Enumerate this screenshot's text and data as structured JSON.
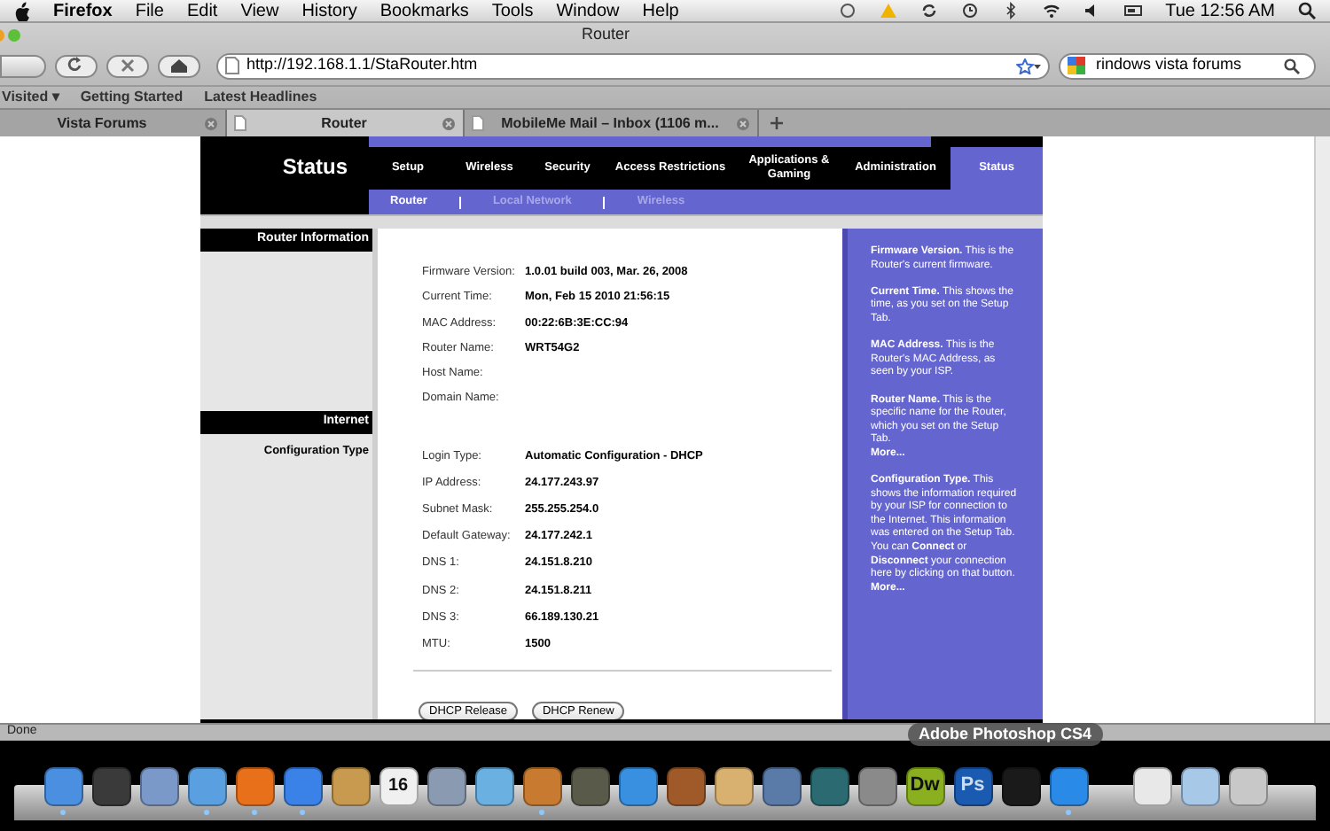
{
  "menu_bar": {
    "items": [
      "Firefox",
      "File",
      "Edit",
      "View",
      "History",
      "Bookmarks",
      "Tools",
      "Window",
      "Help"
    ],
    "clock": "Tue 12:56 AM"
  },
  "window": {
    "title": "Router"
  },
  "toolbar": {
    "url": "http://192.168.1.1/StaRouter.htm",
    "search": "rindows vista forums"
  },
  "bookmarks": [
    "Visited ▾",
    "Getting Started",
    "Latest Headlines"
  ],
  "tabs": [
    {
      "label": "Vista Forums",
      "selected": false
    },
    {
      "label": "Router",
      "selected": true
    },
    {
      "label": "MobileMe Mail – Inbox (1106 m...",
      "selected": false
    }
  ],
  "router": {
    "title": "Status",
    "tabs": [
      {
        "label": "Setup",
        "selected": false
      },
      {
        "label": "Wireless",
        "selected": false
      },
      {
        "label": "Security",
        "selected": false
      },
      {
        "label": "Access Restrictions",
        "selected": false
      },
      {
        "label": "Applications & Gaming",
        "selected": false
      },
      {
        "label": "Administration",
        "selected": false
      },
      {
        "label": "Status",
        "selected": true
      }
    ],
    "subtabs": [
      {
        "label": "Router",
        "selected": true
      },
      {
        "label": "Local Network",
        "selected": false
      },
      {
        "label": "Wireless",
        "selected": false
      }
    ],
    "sections": [
      {
        "heading": "Router Information",
        "rows": [
          {
            "label": "Firmware Version:",
            "value": "1.0.01 build 003, Mar. 26, 2008"
          },
          {
            "label": "Current Time:",
            "value": "Mon, Feb 15 2010 21:56:15"
          },
          {
            "label": "MAC Address:",
            "value": "00:22:6B:3E:CC:94"
          },
          {
            "label": "Router Name:",
            "value": "WRT54G2"
          },
          {
            "label": "Host Name:"
          },
          {
            "label": "Domain Name:"
          }
        ]
      },
      {
        "heading": "Internet",
        "sublabel": "Configuration Type",
        "rows": [
          {
            "label": "Login Type:",
            "value": "Automatic Configuration - DHCP"
          },
          {
            "label": "IP Address:",
            "value": "24.177.243.97"
          },
          {
            "label": "Subnet Mask:",
            "value": "255.255.254.0"
          },
          {
            "label": "Default Gateway:",
            "value": "24.177.242.1"
          },
          {
            "label": "DNS 1:",
            "value": "24.151.8.210"
          },
          {
            "label": "DNS 2:",
            "value": "24.151.8.211"
          },
          {
            "label": "DNS 3:",
            "value": "66.189.130.21"
          },
          {
            "label": "MTU:",
            "value": "1500"
          }
        ]
      }
    ],
    "buttons": [
      "DHCP Release",
      "DHCP Renew"
    ],
    "help": [
      {
        "text": "**Firmware Version.** This is the Router's current firmware."
      },
      {
        "text": "**Current Time.** This shows the time, as you set on the Setup Tab."
      },
      {
        "text": "**MAC Address.** This is the Router's MAC Address, as seen by your ISP."
      },
      {
        "text": "**Router Name.** This is the specific name for the Router, which you set on the Setup Tab.",
        "more": "More..."
      },
      {
        "text": "**Configuration Type.** This shows the information required by your ISP for connection to the Internet. This information was entered on the Setup Tab. You can **Connect** or **Disconnect** your connection here by clicking on that button.",
        "more": "More..."
      }
    ]
  },
  "status_bar": "Done",
  "dock": {
    "tooltip": "Adobe Photoshop CS4",
    "apps": [
      {
        "color": "#4a8fe0",
        "running": true
      },
      {
        "color": "#3a3a3a",
        "running": false
      },
      {
        "color": "#7a98c8",
        "running": false
      },
      {
        "color": "#5aa0e0",
        "running": true
      },
      {
        "color": "#e8701a",
        "running": true
      },
      {
        "color": "#3a82e8",
        "running": true
      },
      {
        "color": "#c89a50",
        "running": false
      },
      {
        "color": "#f0f0f0",
        "label": "16",
        "running": false
      },
      {
        "color": "#8a9ab0",
        "running": false
      },
      {
        "color": "#6ab0e0",
        "running": false
      },
      {
        "color": "#c87a30",
        "running": true
      },
      {
        "color": "#5a5a4a",
        "running": false
      },
      {
        "color": "#3a90e0",
        "running": false
      },
      {
        "color": "#a05a2a",
        "running": false
      },
      {
        "color": "#d8b070",
        "running": false
      },
      {
        "color": "#5a7aa8",
        "running": false
      },
      {
        "color": "#2a6a70",
        "running": false
      },
      {
        "color": "#8a8a8a",
        "running": false
      },
      {
        "color": "#8ab020",
        "label": "Dw",
        "running": false
      },
      {
        "color": "#1a5ab0",
        "label": "Ps",
        "running": false
      },
      {
        "color": "#1a1a1a",
        "running": false
      },
      {
        "color": "#2a8ae8",
        "running": true
      },
      {
        "color": "#e8e8e8",
        "running": false
      },
      {
        "color": "#a8c8e8",
        "running": false
      },
      {
        "color": "#c8c8c8",
        "running": false
      }
    ]
  }
}
